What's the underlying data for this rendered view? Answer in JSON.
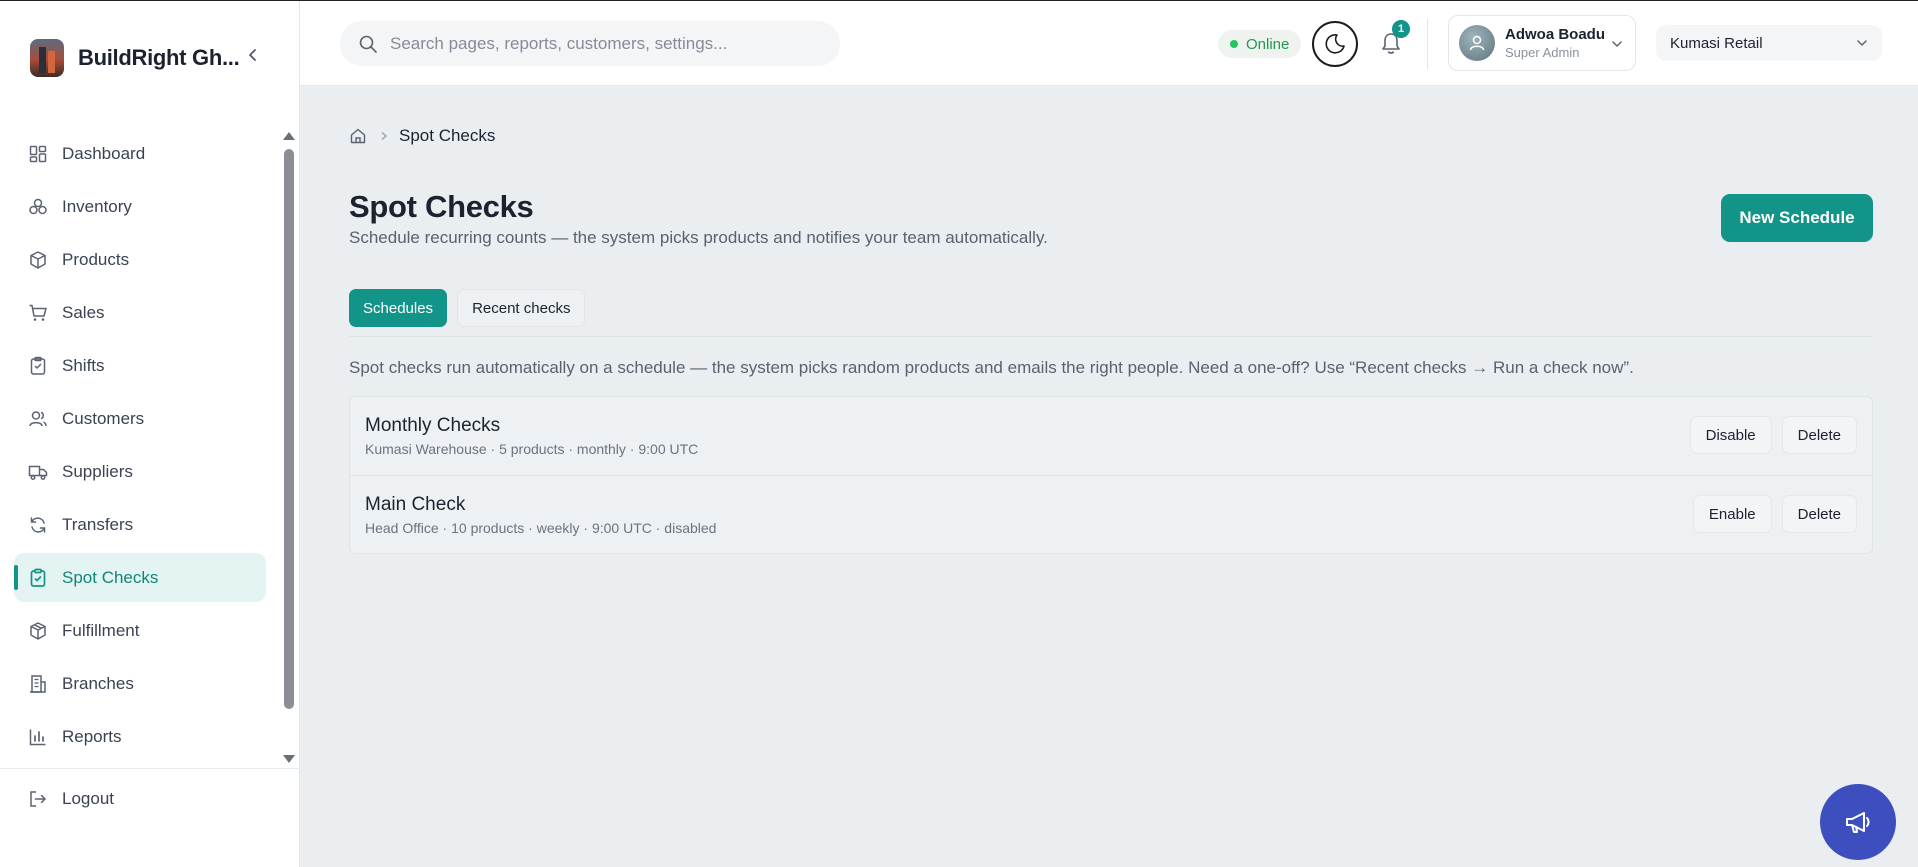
{
  "brand": {
    "name": "BuildRight Gh..."
  },
  "sidebar": {
    "items": [
      {
        "label": "Dashboard",
        "icon": "dashboard-icon"
      },
      {
        "label": "Inventory",
        "icon": "inventory-icon"
      },
      {
        "label": "Products",
        "icon": "box-icon"
      },
      {
        "label": "Sales",
        "icon": "cart-icon"
      },
      {
        "label": "Shifts",
        "icon": "clipboard-icon"
      },
      {
        "label": "Customers",
        "icon": "users-icon"
      },
      {
        "label": "Suppliers",
        "icon": "truck-icon"
      },
      {
        "label": "Transfers",
        "icon": "refresh-icon"
      },
      {
        "label": "Spot Checks",
        "icon": "clipboard-check-icon",
        "active": true
      },
      {
        "label": "Fulfillment",
        "icon": "package-icon"
      },
      {
        "label": "Branches",
        "icon": "building-icon"
      },
      {
        "label": "Reports",
        "icon": "bar-chart-icon"
      }
    ],
    "logout_label": "Logout"
  },
  "topbar": {
    "search_placeholder": "Search pages, reports, customers, settings...",
    "status": "Online",
    "notifications_count": "1",
    "user": {
      "name": "Adwoa Boadu",
      "role": "Super Admin"
    },
    "branch": "Kumasi Retail"
  },
  "breadcrumb": {
    "current": "Spot Checks"
  },
  "page": {
    "title": "Spot Checks",
    "subtitle": "Schedule recurring counts — the system picks products and notifies your team automatically.",
    "new_button": "New Schedule",
    "tabs": [
      {
        "label": "Schedules",
        "active": true
      },
      {
        "label": "Recent checks",
        "active": false
      }
    ],
    "info": "Spot checks run automatically on a schedule — the system picks random products and emails the right people. Need a one-off? Use “Recent checks → Run a check now”.",
    "schedules": [
      {
        "title": "Monthly Checks",
        "meta": "Kumasi Warehouse · 5 products · monthly · 9:00 UTC",
        "toggle_label": "Disable",
        "delete_label": "Delete"
      },
      {
        "title": "Main Check",
        "meta": "Head Office · 10 products · weekly · 9:00 UTC · disabled",
        "toggle_label": "Enable",
        "delete_label": "Delete"
      }
    ]
  },
  "colors": {
    "accent": "#139488",
    "fab": "#3d4fbf",
    "online": "#22c55e"
  }
}
